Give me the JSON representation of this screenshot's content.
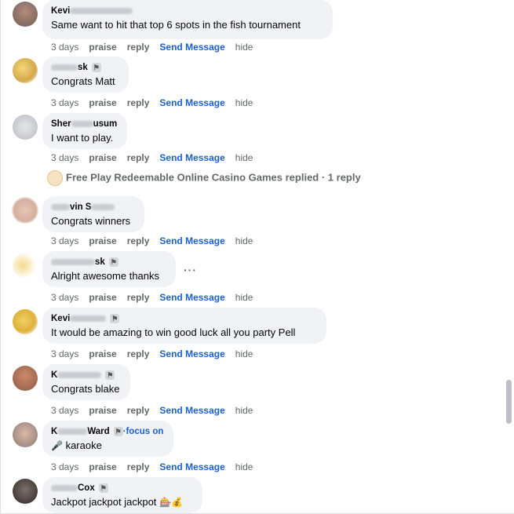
{
  "actions": {
    "time": "3 days",
    "praise": "praise",
    "reply": "reply",
    "send": "Send Message",
    "hide": "hide"
  },
  "comments": [
    {
      "name": "Kevi",
      "text": "Same want to hit that top 6 spots in the fish tournament"
    },
    {
      "name": "sk",
      "text": "Congrats Matt"
    },
    {
      "name_a": "Sher",
      "name_b": "usum",
      "text": "I want to play."
    },
    {
      "name": "vin S",
      "text": "Congrats winners"
    },
    {
      "name": "sk",
      "text": "Alright awesome thanks"
    },
    {
      "name": "Kevi",
      "text": "It would be amazing to win good luck all you party Pell"
    },
    {
      "name": "K",
      "text": "Congrats blake"
    },
    {
      "name_a": "K",
      "name_b": "Ward",
      "focus": "·focus on",
      "text": "karaoke"
    },
    {
      "name": "Cox",
      "text": "Jackpot jackpot jackpot"
    }
  ],
  "replies_link": "Free Play Redeemable Online Casino Games replied · 1 reply",
  "more_dots": "···",
  "icons": {
    "mic": "🎤",
    "slot": "🎰",
    "moneybag": "💰",
    "badge": "flag-icon"
  },
  "colors": {
    "link": "#1b5fd1",
    "bubble": "#f0f2f5",
    "meta": "#65676b"
  }
}
